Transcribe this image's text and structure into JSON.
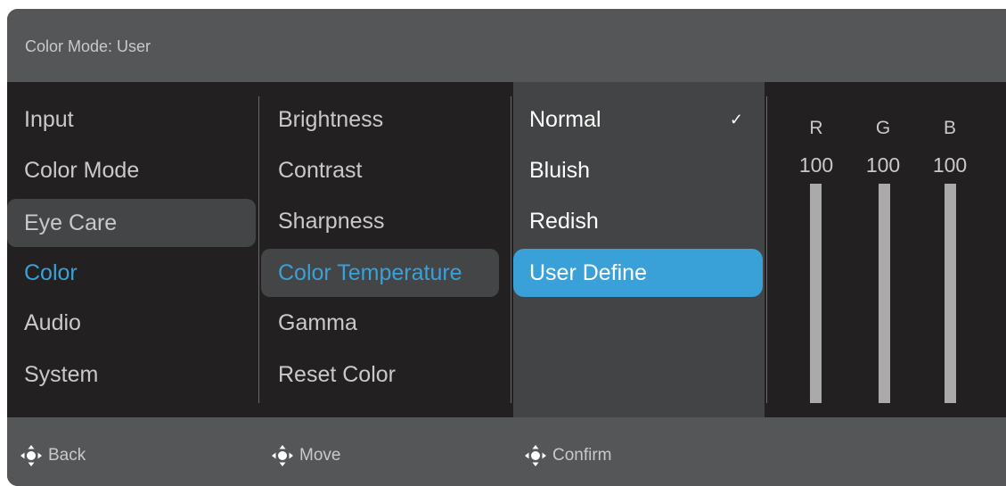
{
  "header": {
    "title": "Color Mode: User"
  },
  "main_menu": {
    "items": [
      {
        "label": "Input"
      },
      {
        "label": "Color Mode"
      },
      {
        "label": "Eye Care"
      },
      {
        "label": "Color"
      },
      {
        "label": "Audio"
      },
      {
        "label": "System"
      }
    ],
    "hovered": "Eye Care",
    "active": "Color"
  },
  "sub_menu": {
    "items": [
      {
        "label": "Brightness"
      },
      {
        "label": "Contrast"
      },
      {
        "label": "Sharpness"
      },
      {
        "label": "Color Temperature"
      },
      {
        "label": "Gamma"
      },
      {
        "label": "Reset Color"
      }
    ],
    "active": "Color Temperature"
  },
  "options": {
    "items": [
      {
        "label": "Normal",
        "checked": true
      },
      {
        "label": "Bluish"
      },
      {
        "label": "Redish"
      },
      {
        "label": "User Define"
      }
    ],
    "check_mark": "✓",
    "selected": "User Define"
  },
  "rgb": {
    "channels": [
      {
        "label": "R",
        "value": "100"
      },
      {
        "label": "G",
        "value": "100"
      },
      {
        "label": "B",
        "value": "100"
      }
    ]
  },
  "footer": {
    "back": "Back",
    "move": "Move",
    "confirm": "Confirm"
  },
  "colors": {
    "accent": "#3aa0d8",
    "panel": "#232021",
    "bar": "#555657"
  },
  "icons": {
    "navigation": "joystick-icon"
  }
}
